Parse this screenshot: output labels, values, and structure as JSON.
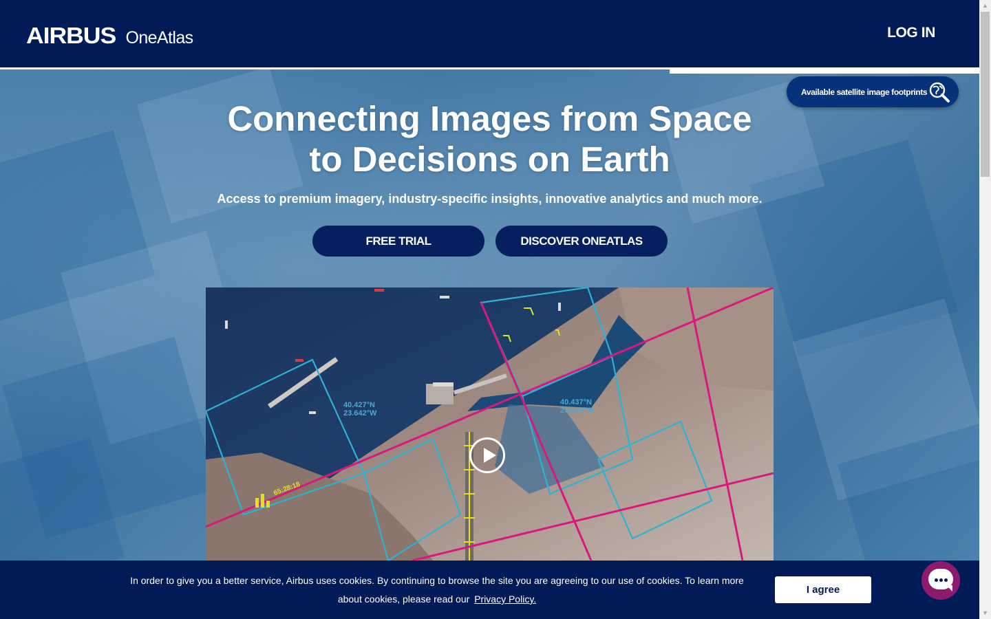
{
  "header": {
    "brand": "AIRBUS",
    "product": "OneAtlas",
    "login_label": "LOG IN"
  },
  "footprints": {
    "label": "Available satellite image footprints",
    "icon": "globe-search-icon"
  },
  "hero": {
    "title_line1": "Connecting Images from Space",
    "title_line2": "to Decisions on Earth",
    "subtitle": "Access to premium imagery, industry-specific insights, innovative analytics and much more.",
    "cta_trial": "FREE TRIAL",
    "cta_discover": "DISCOVER ONEATLAS"
  },
  "video": {
    "coord_a_lat": "40.427°N",
    "coord_a_lon": "23.642°W",
    "coord_b_lat": "40.437°N",
    "coord_b_lon": "23.642°W",
    "tag": "65:28:18",
    "play_icon": "play-icon"
  },
  "cookie": {
    "text": "In order to give you a better service, Airbus uses cookies. By continuing to browse the site you are agreeing to our use of cookies. To learn more about cookies, please read our",
    "link": "Privacy Policy.",
    "agree": "I agree"
  },
  "chat": {
    "icon": "chat-icon"
  },
  "colors": {
    "navy": "#001b57",
    "button": "#06205f",
    "accent_magenta": "#d9187d",
    "accent_cyan": "#2bb3d6",
    "chat": "#8c1b6e"
  }
}
